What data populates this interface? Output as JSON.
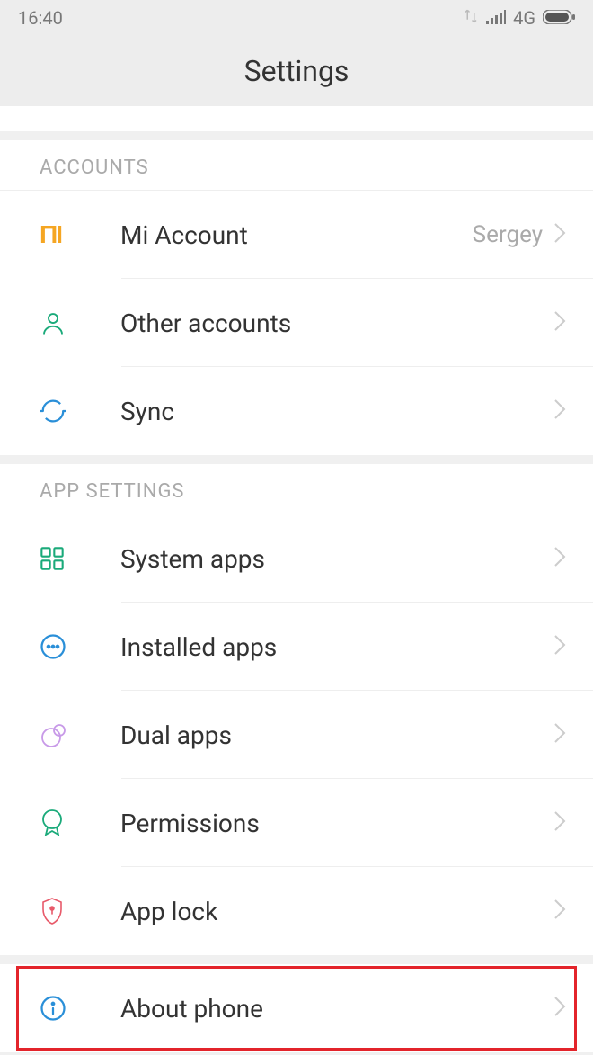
{
  "statusBar": {
    "time": "16:40",
    "network": "4G"
  },
  "header": {
    "title": "Settings"
  },
  "sections": {
    "accounts": {
      "title": "ACCOUNTS",
      "items": [
        {
          "label": "Mi Account",
          "value": "Sergey"
        },
        {
          "label": "Other accounts"
        },
        {
          "label": "Sync"
        }
      ]
    },
    "appSettings": {
      "title": "APP SETTINGS",
      "items": [
        {
          "label": "System apps"
        },
        {
          "label": "Installed apps"
        },
        {
          "label": "Dual apps"
        },
        {
          "label": "Permissions"
        },
        {
          "label": "App lock"
        }
      ]
    },
    "about": {
      "items": [
        {
          "label": "About phone"
        }
      ]
    }
  }
}
